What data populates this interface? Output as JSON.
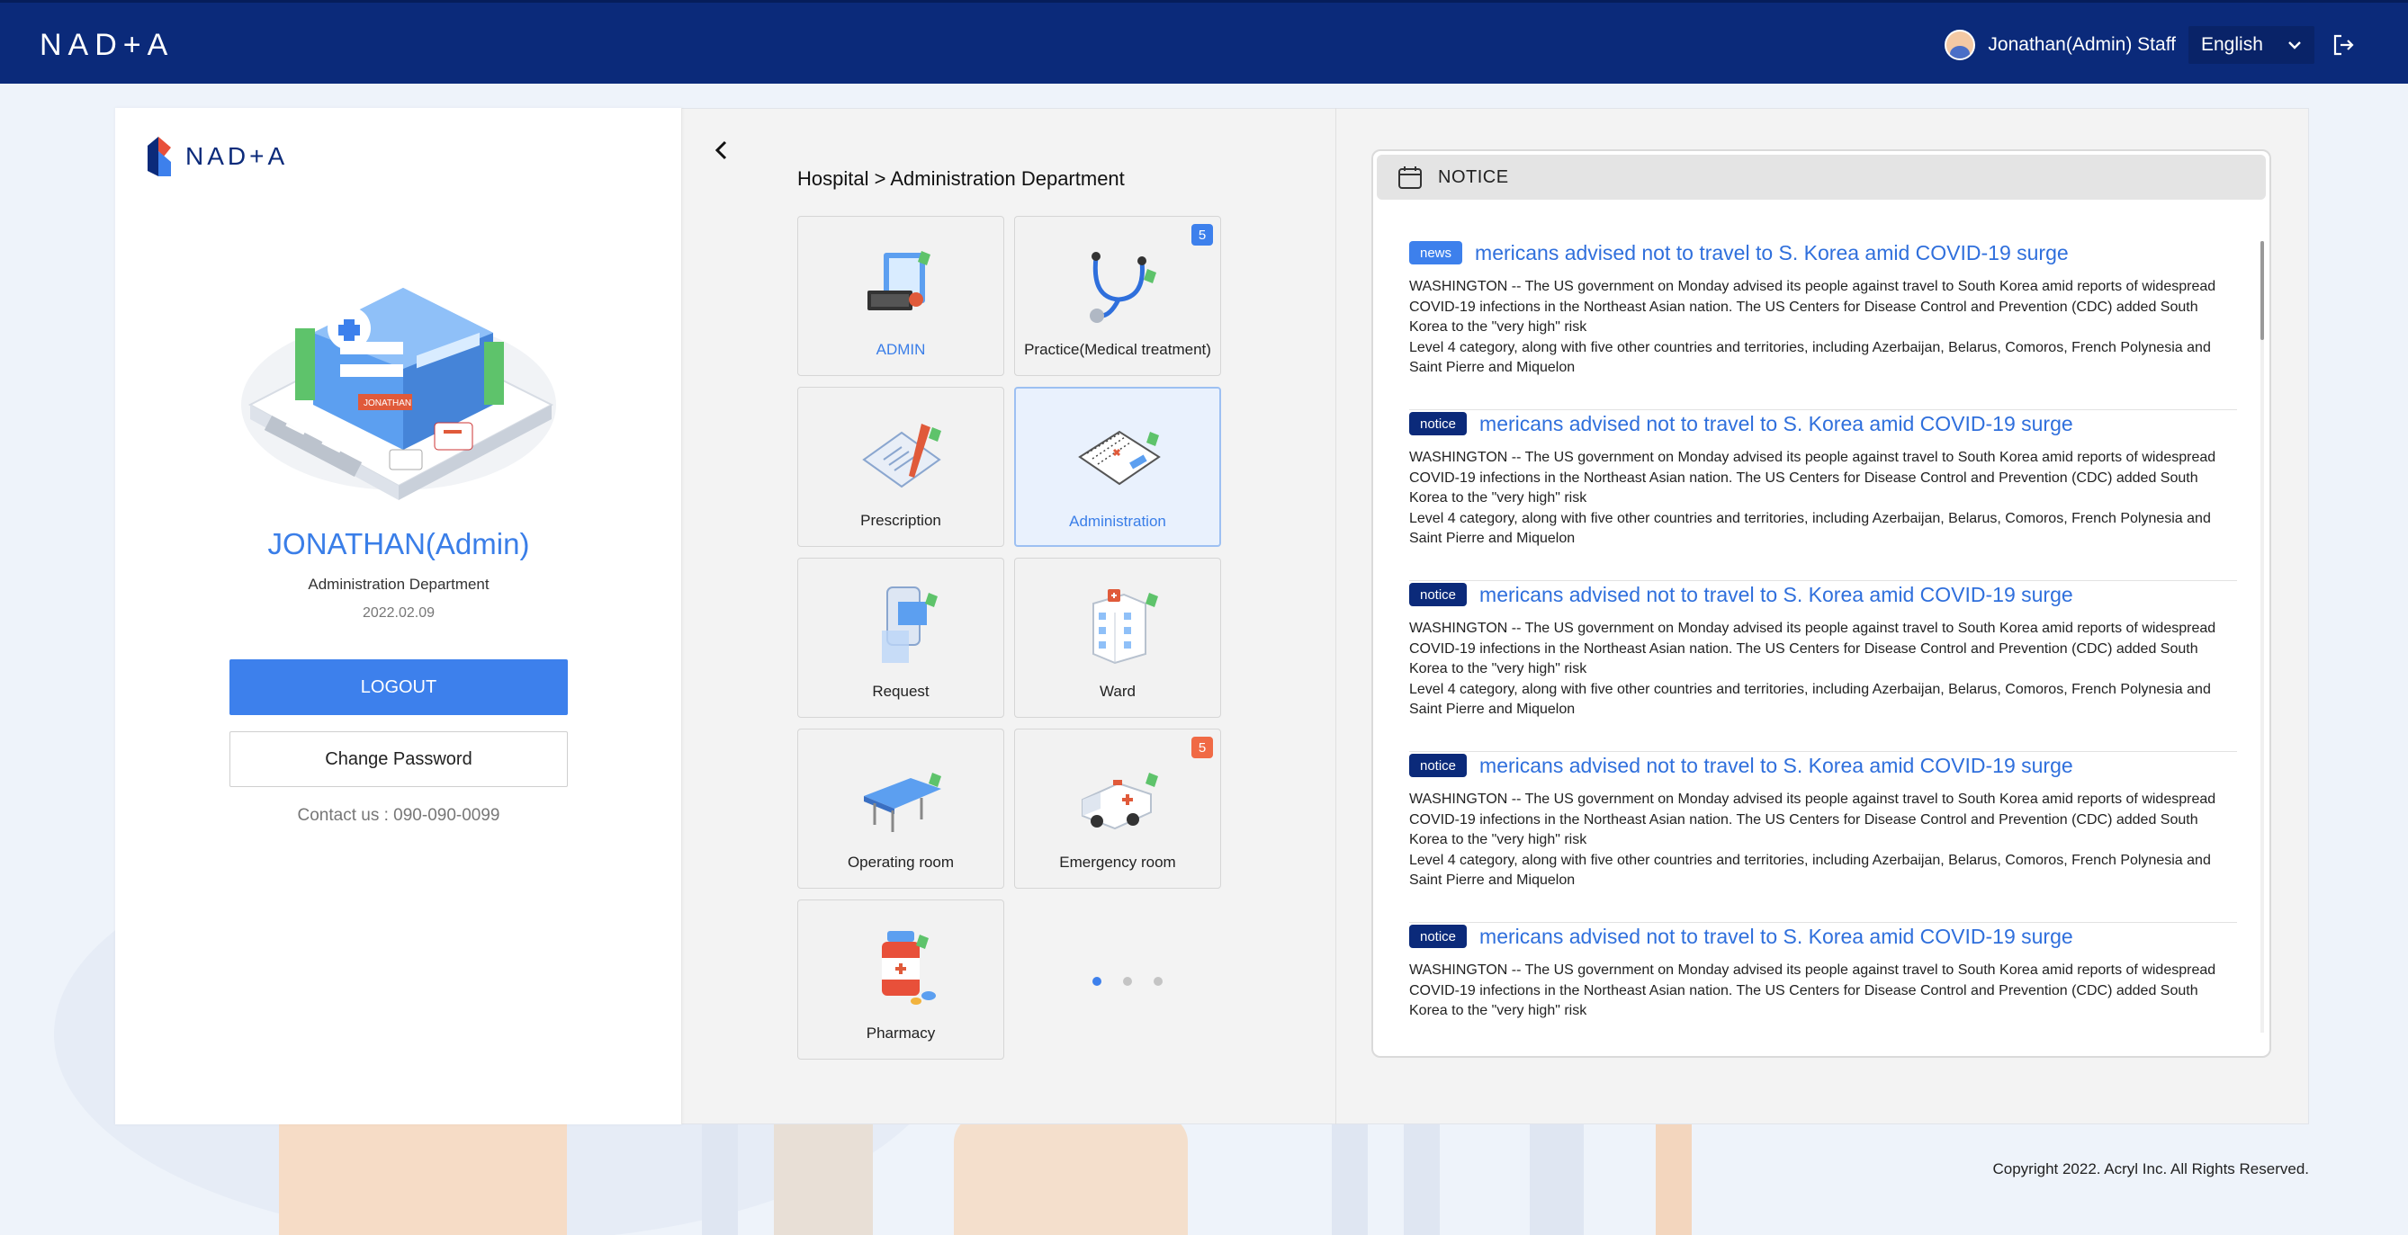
{
  "topbar": {
    "logo_text": "NAD+A",
    "user_label": "Jonathan(Admin) Staff",
    "language": "English"
  },
  "profile": {
    "logo_text": "NAD+A",
    "illustration_sign": "JONATHAN",
    "name": "JONATHAN(Admin)",
    "department": "Administration Department",
    "date": "2022.02.09",
    "logout_label": "LOGOUT",
    "change_password_label": "Change Password",
    "contact": "Contact us : 090-090-0099"
  },
  "menu": {
    "breadcrumb": "Hospital > Administration Department",
    "tiles": [
      {
        "label": "ADMIN",
        "icon": "admin-icon",
        "badge": null,
        "active": false
      },
      {
        "label": "Practice(Medical treatment)",
        "icon": "stethoscope-icon",
        "badge": "5",
        "badge_color": "#3d80ec",
        "active": false
      },
      {
        "label": "Prescription",
        "icon": "prescription-icon",
        "badge": null,
        "active": false
      },
      {
        "label": "Administration",
        "icon": "administration-icon",
        "badge": null,
        "active": true
      },
      {
        "label": "Request",
        "icon": "request-icon",
        "badge": null,
        "active": false
      },
      {
        "label": "Ward",
        "icon": "ward-icon",
        "badge": null,
        "active": false
      },
      {
        "label": "Operating room",
        "icon": "operating-bed-icon",
        "badge": null,
        "active": false
      },
      {
        "label": "Emergency room",
        "icon": "ambulance-icon",
        "badge": "5",
        "badge_color": "#f06a45",
        "active": false
      },
      {
        "label": "Pharmacy",
        "icon": "pill-bottle-icon",
        "badge": null,
        "active": false
      }
    ],
    "pagination": {
      "pages": 3,
      "current": 1
    }
  },
  "notice": {
    "title": "NOTICE",
    "items": [
      {
        "tag": "news",
        "headline": "mericans advised not to travel to S. Korea amid COVID-19 surge",
        "body": "WASHINGTON -- The US government on Monday advised its people against travel to South Korea amid reports of widespread COVID-19 infections in the Northeast Asian nation. The US Centers for Disease Control and Prevention (CDC) added South Korea to the \"very high\" risk\nLevel 4 category, along with five other countries and territories, including Azerbaijan, Belarus, Comoros, French Polynesia and Saint Pierre and Miquelon"
      },
      {
        "tag": "notice",
        "headline": "mericans advised not to travel to S. Korea amid COVID-19 surge",
        "body": "WASHINGTON -- The US government on Monday advised its people against travel to South Korea amid reports of widespread COVID-19 infections in the Northeast Asian nation. The US Centers for Disease Control and Prevention (CDC) added South Korea to the \"very high\" risk\nLevel 4 category, along with five other countries and territories, including Azerbaijan, Belarus, Comoros, French Polynesia and Saint Pierre and Miquelon"
      },
      {
        "tag": "notice",
        "headline": "mericans advised not to travel to S. Korea amid COVID-19 surge",
        "body": "WASHINGTON -- The US government on Monday advised its people against travel to South Korea amid reports of widespread COVID-19 infections in the Northeast Asian nation. The US Centers for Disease Control and Prevention (CDC) added South Korea to the \"very high\" risk\nLevel 4 category, along with five other countries and territories, including Azerbaijan, Belarus, Comoros, French Polynesia and Saint Pierre and Miquelon"
      },
      {
        "tag": "notice",
        "headline": "mericans advised not to travel to S. Korea amid COVID-19 surge",
        "body": "WASHINGTON -- The US government on Monday advised its people against travel to South Korea amid reports of widespread COVID-19 infections in the Northeast Asian nation. The US Centers for Disease Control and Prevention (CDC) added South Korea to the \"very high\" risk\nLevel 4 category, along with five other countries and territories, including Azerbaijan, Belarus, Comoros, French Polynesia and Saint Pierre and Miquelon"
      },
      {
        "tag": "notice",
        "headline": "mericans advised not to travel to S. Korea amid COVID-19 surge",
        "body": "WASHINGTON -- The US government on Monday advised its people against travel to South Korea amid reports of widespread COVID-19 infections in the Northeast Asian nation. The US Centers for Disease Control and Prevention (CDC) added South Korea to the \"very high\" risk"
      }
    ]
  },
  "footer": {
    "copyright": "Copyright 2022. Acryl Inc. All Rights Reserved."
  },
  "colors": {
    "topbar": "#0b2a7a",
    "accent": "#3d80ec",
    "notice_tag": "#0b2a7a",
    "badge_blue": "#3d80ec",
    "badge_orange": "#f06a45"
  }
}
